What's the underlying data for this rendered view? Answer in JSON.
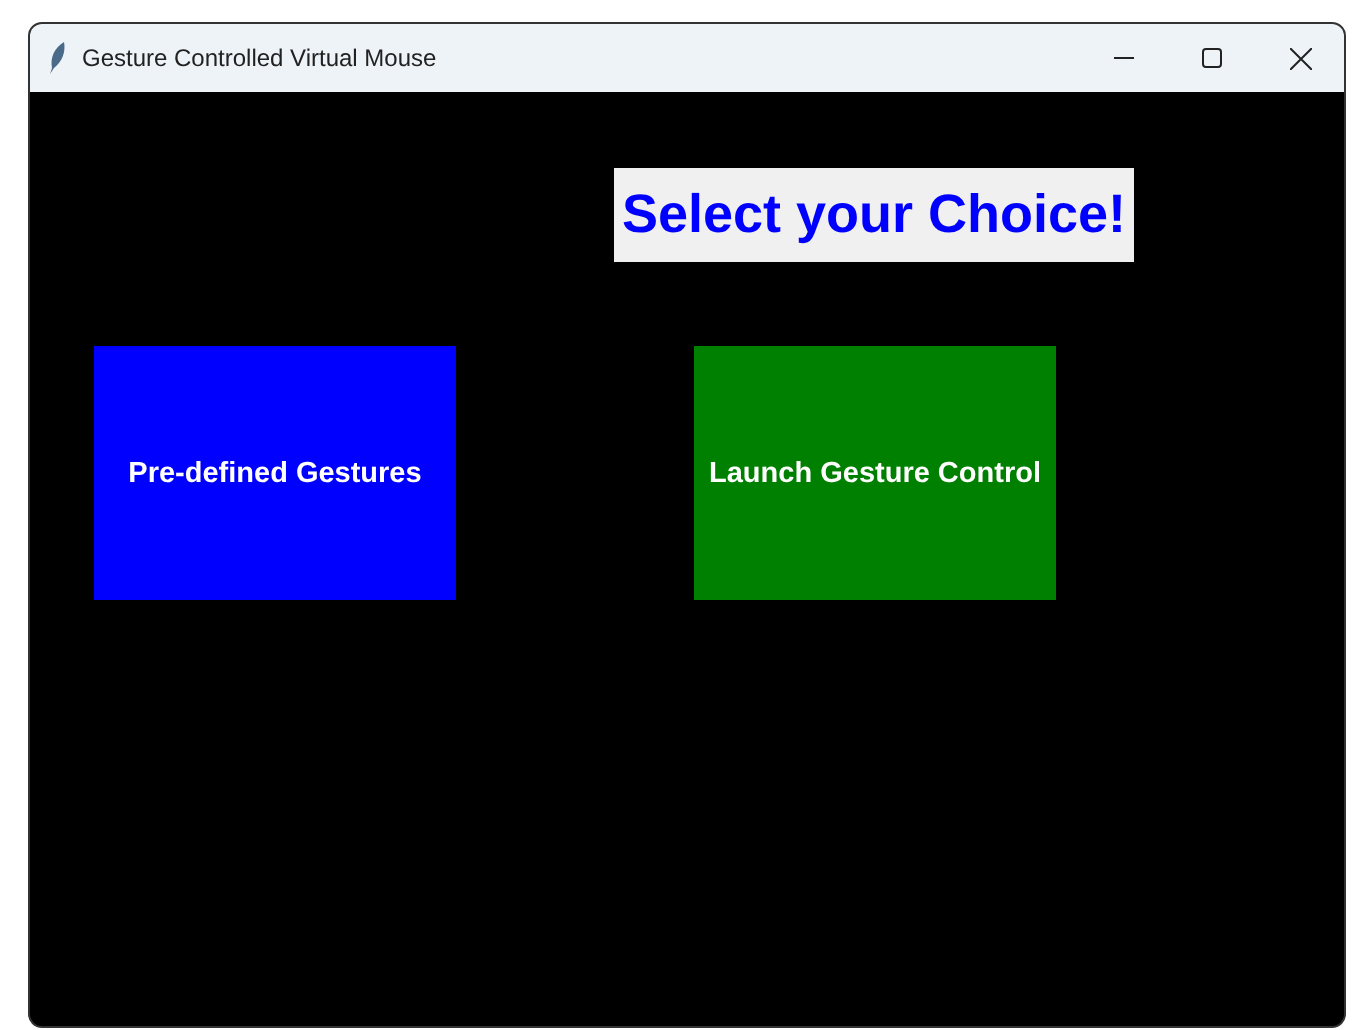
{
  "window": {
    "title": "Gesture Controlled Virtual Mouse"
  },
  "heading": "Select your Choice!",
  "buttons": [
    {
      "label": "Pre-defined Gestures",
      "color": "#0000ff"
    },
    {
      "label": "Launch Gesture Control",
      "color": "#008000"
    }
  ]
}
